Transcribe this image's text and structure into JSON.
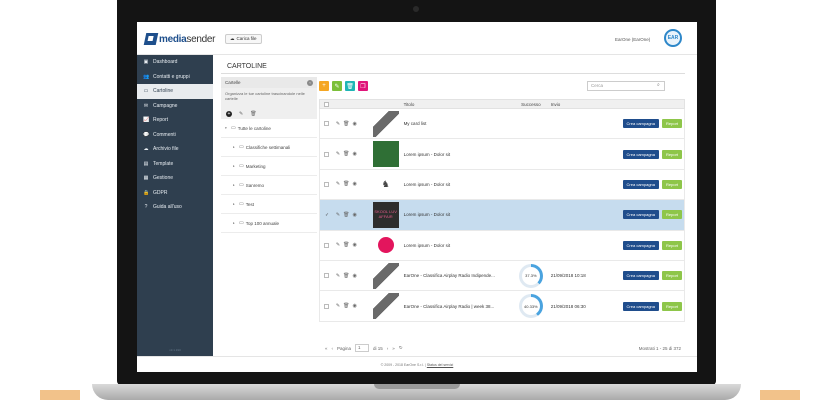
{
  "app": {
    "brand_bold": "media",
    "brand_thin": "sender",
    "upload_label": "Carica file",
    "user_name": "EarOne (EarOne)",
    "avatar_text": "EAR"
  },
  "sidebar": {
    "items": [
      {
        "label": "Dashboard",
        "icon": "dashboard-icon",
        "glyph": "▣"
      },
      {
        "label": "Contatti e gruppi",
        "icon": "users-icon",
        "glyph": "👥"
      },
      {
        "label": "Cartoline",
        "icon": "postcard-icon",
        "glyph": "▭",
        "active": true
      },
      {
        "label": "Campagne",
        "icon": "envelope-icon",
        "glyph": "✉"
      },
      {
        "label": "Report",
        "icon": "chart-icon",
        "glyph": "📈"
      },
      {
        "label": "Commenti",
        "icon": "comments-icon",
        "glyph": "💬"
      },
      {
        "label": "Archivio file",
        "icon": "cloud-icon",
        "glyph": "☁"
      },
      {
        "label": "Template",
        "icon": "template-icon",
        "glyph": "▤"
      },
      {
        "label": "Gestione",
        "icon": "folder-icon",
        "glyph": "▦"
      },
      {
        "label": "GDPR",
        "icon": "lock-icon",
        "glyph": "🔒"
      },
      {
        "label": "Guida all'uso",
        "icon": "help-icon",
        "glyph": "?"
      }
    ],
    "version": "v3.1.190"
  },
  "page": {
    "title": "CARTOLINE"
  },
  "folders": {
    "header": "Cartelle",
    "description": "Organizza le tue cartoline trascinandole nelle cartelle",
    "root": "Tutte le cartoline",
    "children": [
      "Classifiche settimanali",
      "Marketing",
      "Sanremo",
      "Test",
      "Top 100 annuale"
    ]
  },
  "grid": {
    "search_placeholder": "Cerca",
    "columns": {
      "title": "Titolo",
      "success": "Successo",
      "sent": "Invio"
    },
    "campaign_label": "Crea campagna",
    "report_label": "Report",
    "rows": [
      {
        "title": "My card list",
        "thumb": "placeholder",
        "success": "",
        "sent": "",
        "selected": false
      },
      {
        "title": "Lorem ipsum - Dolor sit",
        "thumb": "green",
        "success": "",
        "sent": "",
        "selected": false
      },
      {
        "title": "Lorem ipsum - Dolor sit",
        "thumb": "figure",
        "success": "",
        "sent": "",
        "selected": false
      },
      {
        "title": "Lorem ipsum - Dolor sit",
        "thumb": "dark",
        "thumb_text": "SKOOL LUV AFFAIR",
        "success": "",
        "sent": "",
        "selected": true
      },
      {
        "title": "Lorem ipsum - Dolor sit",
        "thumb": "pink",
        "success": "",
        "sent": "",
        "selected": false
      },
      {
        "title": "EarOne - Classifica Airplay Radio Indipende...",
        "thumb": "placeholder",
        "success": "37.3%",
        "success_value": 37.3,
        "sent": "21/09/2018 10:18",
        "selected": false
      },
      {
        "title": "EarOne - Classifica Airplay Radio | week 38...",
        "thumb": "placeholder",
        "success": "40.33%",
        "success_value": 40.33,
        "sent": "21/09/2018 06:30",
        "selected": false
      }
    ],
    "pager": {
      "page_label": "Pagina",
      "page_value": "1",
      "of_label": "di 15",
      "info": "Mostrati 1 - 25 di 372"
    }
  },
  "footer": {
    "text": "© 2009 - 2018 EarOne S.r.l. |",
    "link": "Status del servizi"
  },
  "colors": {
    "sidebar": "#2f3f4f",
    "campaign": "#1f4d8c",
    "report": "#8ec64a",
    "donut": "#4aa3df",
    "toolbar": [
      "#f5a623",
      "#7bbf3a",
      "#1fb5b5",
      "#e0157a"
    ]
  }
}
